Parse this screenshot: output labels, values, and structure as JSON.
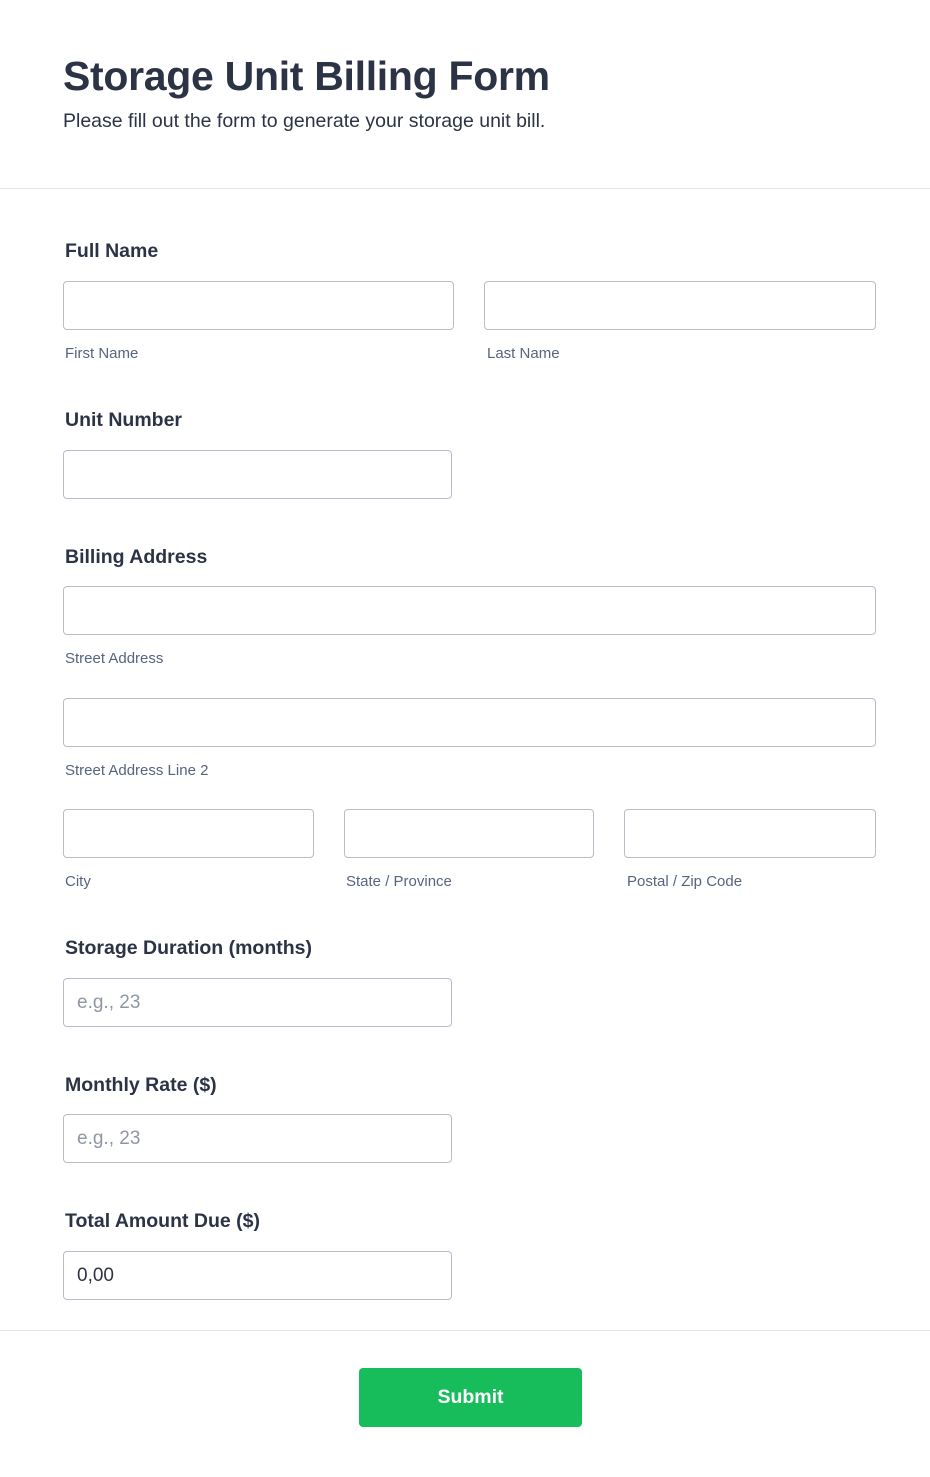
{
  "header": {
    "title": "Storage Unit Billing Form",
    "subtitle": "Please fill out the form to generate your storage unit bill."
  },
  "full_name": {
    "label": "Full Name",
    "first_name": {
      "sublabel": "First Name",
      "value": "",
      "placeholder": ""
    },
    "last_name": {
      "sublabel": "Last Name",
      "value": "",
      "placeholder": ""
    }
  },
  "unit_number": {
    "label": "Unit Number",
    "value": "",
    "placeholder": ""
  },
  "billing_address": {
    "label": "Billing Address",
    "street": {
      "sublabel": "Street Address",
      "value": "",
      "placeholder": ""
    },
    "street2": {
      "sublabel": "Street Address Line 2",
      "value": "",
      "placeholder": ""
    },
    "city": {
      "sublabel": "City",
      "value": "",
      "placeholder": ""
    },
    "state": {
      "sublabel": "State / Province",
      "value": "",
      "placeholder": ""
    },
    "zip": {
      "sublabel": "Postal / Zip Code",
      "value": "",
      "placeholder": ""
    }
  },
  "storage_duration": {
    "label": "Storage Duration (months)",
    "value": "",
    "placeholder": "e.g., 23"
  },
  "monthly_rate": {
    "label": "Monthly Rate ($)",
    "value": "",
    "placeholder": "e.g., 23"
  },
  "total_due": {
    "label": "Total Amount Due ($)",
    "value": "0,00",
    "placeholder": ""
  },
  "submit": {
    "label": "Submit"
  },
  "colors": {
    "text": "#2c3345",
    "sublabel": "#57647e",
    "border": "#b8bdc9",
    "divider": "#e3e5ea",
    "accent": "#18bd5b"
  }
}
